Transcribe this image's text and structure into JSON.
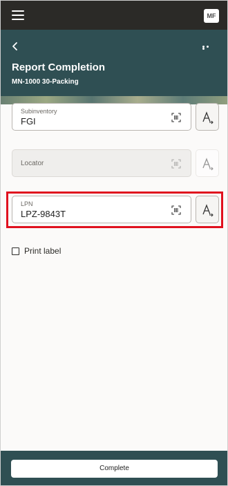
{
  "topbar": {
    "avatar_initials": "MF"
  },
  "header": {
    "title": "Report Completion",
    "subtitle": "MN-1000 30-Packing",
    "background_color": "#2f4f53"
  },
  "fields": {
    "subinventory": {
      "label": "Subinventory",
      "value": "FGI"
    },
    "locator": {
      "label": "Locator",
      "value": "",
      "disabled": true
    },
    "lpn": {
      "label": "LPN",
      "value": "LPZ-9843T",
      "highlighted": true,
      "highlight_color": "#e0101e"
    }
  },
  "print_label": {
    "label": "Print label",
    "checked": false
  },
  "footer": {
    "complete_label": "Complete"
  },
  "icons": {
    "menu": "hamburger-icon",
    "back": "chevron-left-icon",
    "more": "ellipsis-icon",
    "scan": "barcode-scan-icon",
    "font": "font-size-icon"
  }
}
